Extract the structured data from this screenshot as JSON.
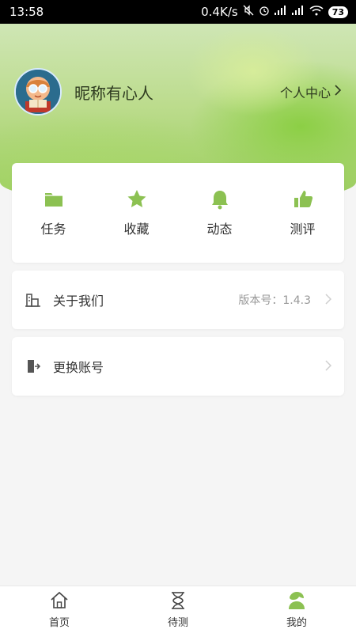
{
  "status_bar": {
    "time": "13:58",
    "net_speed": "0.4K/s",
    "battery": "73",
    "icons": [
      "mute-icon",
      "alarm-icon",
      "signal-icon",
      "signal-icon",
      "wifi-icon",
      "battery-icon"
    ]
  },
  "profile": {
    "nickname": "昵称有心人",
    "center_link": "个人中心",
    "avatar_icon": "avatar-kid-reading-icon"
  },
  "grid": {
    "items": [
      {
        "label": "任务",
        "icon": "folder-icon"
      },
      {
        "label": "收藏",
        "icon": "star-icon"
      },
      {
        "label": "动态",
        "icon": "bell-icon"
      },
      {
        "label": "测评",
        "icon": "thumbs-up-icon"
      }
    ]
  },
  "rows": {
    "about": {
      "label": "关于我们",
      "value": "版本号：1.4.3",
      "icon": "building-icon"
    },
    "switch": {
      "label": "更换账号",
      "icon": "exit-door-icon"
    }
  },
  "nav": {
    "items": [
      {
        "label": "首页",
        "icon": "home-icon"
      },
      {
        "label": "待测",
        "icon": "hourglass-icon"
      },
      {
        "label": "我的",
        "icon": "user-icon"
      }
    ],
    "active": "我的"
  },
  "colors": {
    "accent": "#8cc152",
    "icon_green": "#7cbf3f",
    "header_green": "#9bcc5c"
  }
}
